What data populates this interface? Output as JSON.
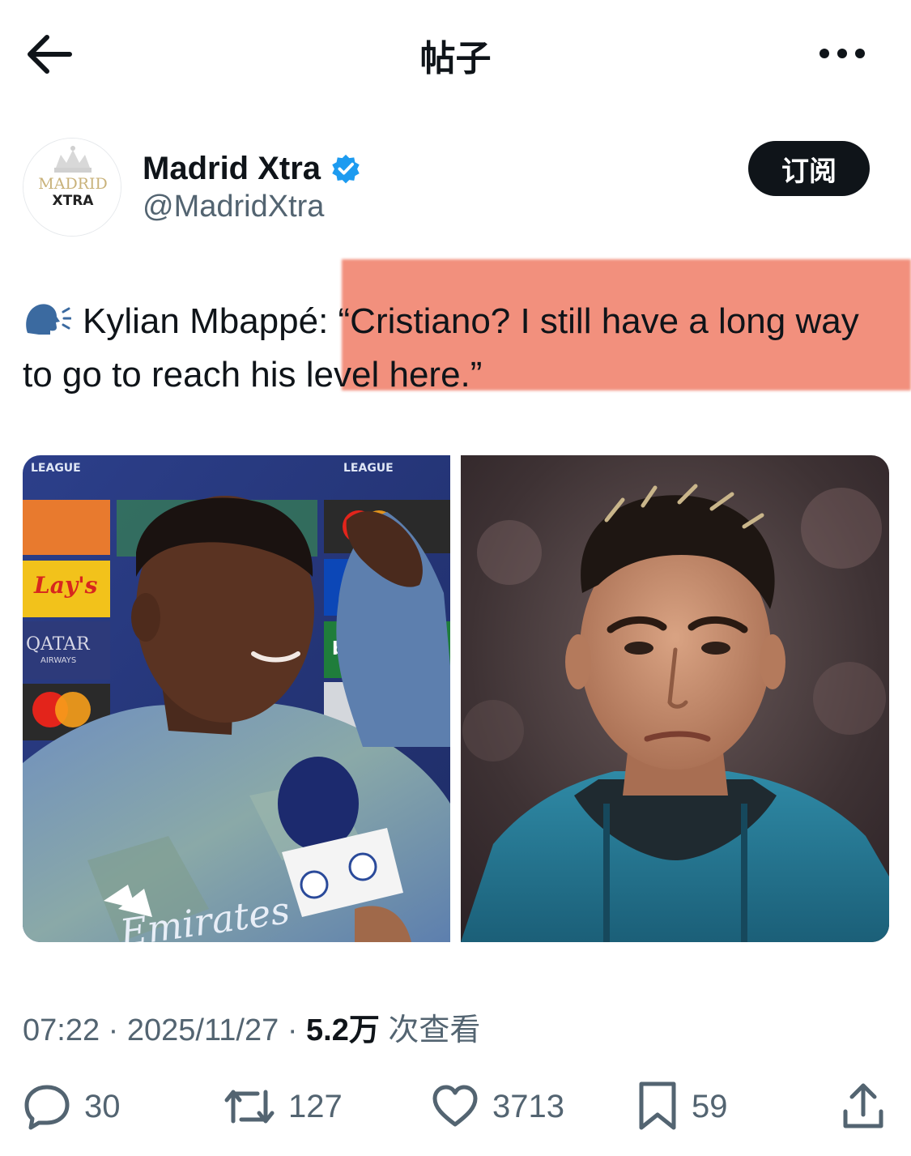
{
  "header": {
    "title": "帖子",
    "back_icon": "arrow-left-icon",
    "more_icon": "more-dots-icon"
  },
  "author": {
    "name": "Madrid Xtra",
    "handle": "@MadridXtra",
    "verified": true,
    "avatar_text_top": "MADRID",
    "avatar_text_bottom": "XTRA",
    "subscribe_label": "订阅"
  },
  "tweet": {
    "emoji_icon": "speaking-head-icon",
    "text": "Kylian Mbappé: “Cristiano? I still have a long way to go to reach his level here.”",
    "images": [
      {
        "name": "mbappe-interview-photo",
        "signage": [
          "LEAGUE",
          "LEAGUE",
          "Lay's",
          "QATAR",
          "AIRWAYS",
          "bet365",
          "Emirates"
        ]
      },
      {
        "name": "ronaldo-portrait-photo"
      }
    ]
  },
  "meta": {
    "time": "07:22",
    "separator": "·",
    "date": "2025/11/27",
    "views_count": "5.2万",
    "views_label": "次查看"
  },
  "actions": {
    "replies": "30",
    "retweets": "127",
    "likes": "3713",
    "bookmarks": "59"
  },
  "colors": {
    "text_primary": "#0f1419",
    "text_secondary": "#536471",
    "verified_blue": "#1d9bf0",
    "highlight": "#ef7860"
  }
}
